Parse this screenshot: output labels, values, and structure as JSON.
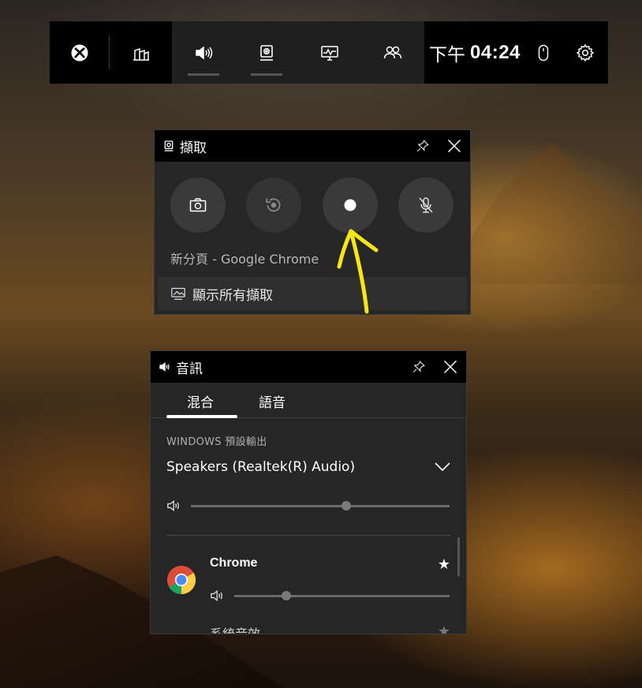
{
  "topbar": {
    "clock": {
      "period": "下午",
      "time": "04:24"
    },
    "icons": [
      "xbox-icon",
      "widget-menu-icon",
      "audio-icon",
      "capture-icon",
      "performance-icon",
      "social-icon",
      "mouse-icon",
      "settings-icon"
    ]
  },
  "capture_widget": {
    "title": "擷取",
    "target_app": "新分頁 - Google Chrome",
    "show_all_label": "顯示所有擷取",
    "buttons": [
      "screenshot",
      "record-last",
      "start-recording",
      "mic-off"
    ]
  },
  "audio_widget": {
    "title": "音訊",
    "tabs": [
      {
        "label": "混合",
        "active": true
      },
      {
        "label": "語音",
        "active": false
      }
    ],
    "section_label": "WINDOWS 預設輸出",
    "output_device": "Speakers (Realtek(R) Audio)",
    "master_volume": 0.6,
    "apps": [
      {
        "name": "Chrome",
        "volume": 0.24,
        "favorite": true
      },
      {
        "name": "系統音效",
        "favorite": true
      }
    ]
  },
  "colors": {
    "annotation": "#f5e614",
    "bar_bg": "#000000",
    "panel_bg": "#262626"
  }
}
